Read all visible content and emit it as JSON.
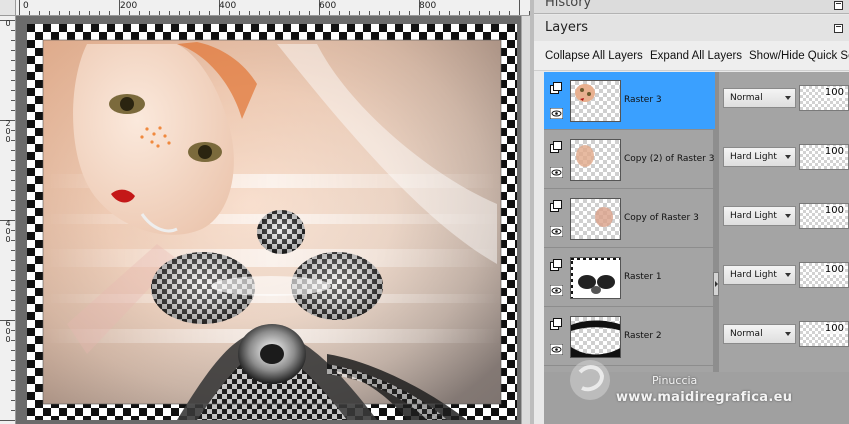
{
  "rulers": {
    "top_labels": [
      "0",
      "200",
      "400",
      "600",
      "800"
    ],
    "left_labels": [
      "0",
      "200",
      "400",
      "600"
    ]
  },
  "history": {
    "title": "History"
  },
  "layers": {
    "title": "Layers",
    "toolbar": {
      "collapse_label": "Collapse All Layers",
      "expand_label": "Expand All Layers",
      "toggle_label": "Show/Hide Quick Se"
    },
    "items": [
      {
        "name": "Raster 3",
        "blend_mode": "Normal",
        "opacity": "100",
        "selected": true
      },
      {
        "name": "Copy (2) of Raster 3",
        "blend_mode": "Hard Light",
        "opacity": "100",
        "selected": false
      },
      {
        "name": "Copy of Raster 3",
        "blend_mode": "Hard Light",
        "opacity": "100",
        "selected": false
      },
      {
        "name": "Raster 1",
        "blend_mode": "Hard Light",
        "opacity": "100",
        "selected": false
      },
      {
        "name": "Raster 2",
        "blend_mode": "Normal",
        "opacity": "100",
        "selected": false
      }
    ]
  },
  "watermark": {
    "name": "Pinuccia",
    "url": "www.maidiregrafica.eu"
  },
  "colors": {
    "selection": "#3aa0ff",
    "panel_gray": "#a4a4a4",
    "canvas_bg": "#6b6b6b"
  },
  "icons": [
    "layer-visibility-icon",
    "eye-icon",
    "chevron-down-icon",
    "pin-icon",
    "panel-resize-grip-icon"
  ]
}
